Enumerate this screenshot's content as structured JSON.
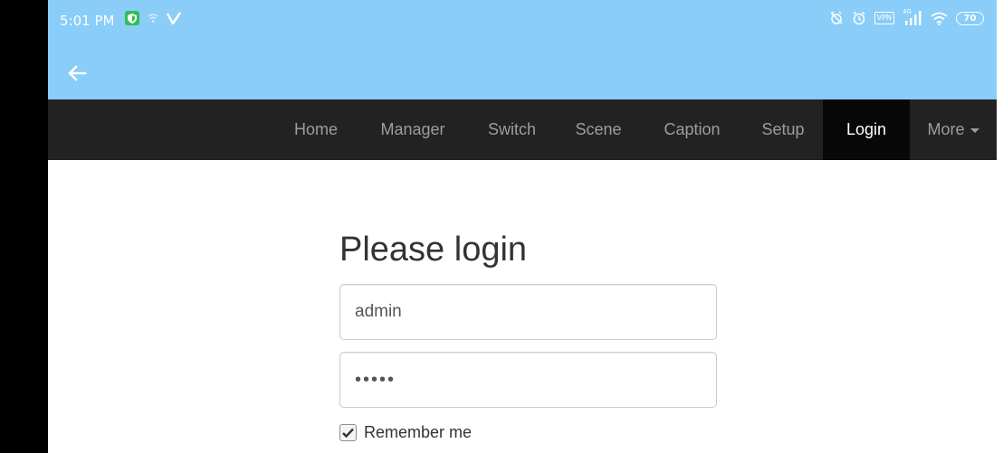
{
  "status_bar": {
    "time": "5:01 PM",
    "vpn_label": "VPN",
    "signal_label": "4G",
    "battery": "70"
  },
  "navbar": {
    "items": [
      {
        "label": "Home"
      },
      {
        "label": "Manager"
      },
      {
        "label": "Switch"
      },
      {
        "label": "Scene"
      },
      {
        "label": "Caption"
      },
      {
        "label": "Setup"
      },
      {
        "label": "Login"
      },
      {
        "label": "More"
      }
    ],
    "active": "Login"
  },
  "login": {
    "title": "Please login",
    "username_value": "admin",
    "password_value": "•••••",
    "remember_label": "Remember me",
    "remember_checked": true
  },
  "colors": {
    "topbar": "#89cdf8",
    "navbar": "#222222",
    "nav_active": "#080808"
  }
}
